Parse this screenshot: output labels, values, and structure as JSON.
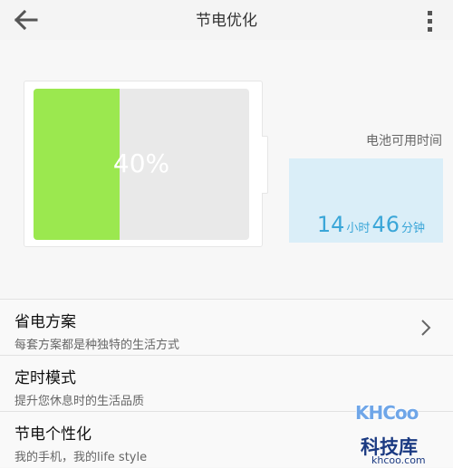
{
  "header": {
    "title": "节电优化",
    "back_icon": "arrow-left-icon",
    "menu_icon": "more-vertical-icon"
  },
  "battery": {
    "percent_text": "40%",
    "level": 0.4,
    "fill_color": "#9be84f"
  },
  "usage": {
    "label": "电池可用时间",
    "hours": "14",
    "hours_unit": "小时",
    "minutes": "46",
    "minutes_unit": "分钟",
    "accent_color": "#3aa6d8"
  },
  "list": {
    "items": [
      {
        "title": "省电方案",
        "subtitle": "每套方案都是种独特的生活方式"
      },
      {
        "title": "定时模式",
        "subtitle": "提升您休息时的生活品质"
      },
      {
        "title": "节电个性化",
        "subtitle": "我的手机，我的life style"
      }
    ]
  },
  "watermark": {
    "logo": "KHCoo",
    "name": "科技库",
    "url": "khcoo.com"
  }
}
